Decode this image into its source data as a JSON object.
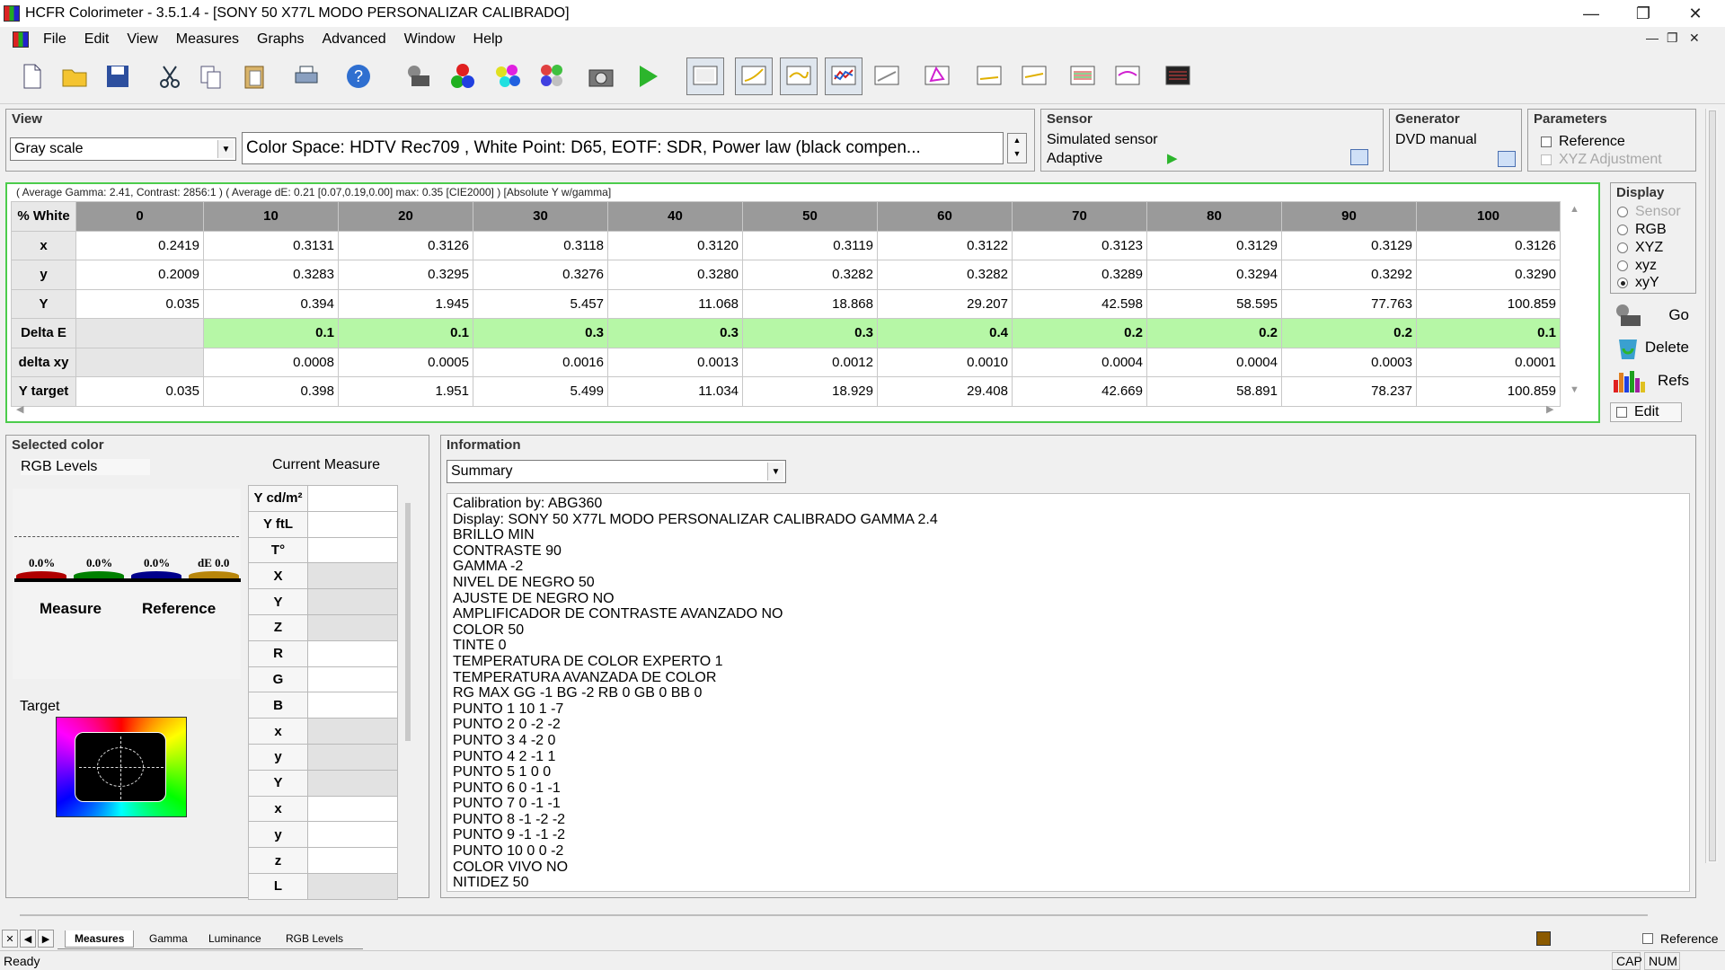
{
  "window": {
    "title": "HCFR Colorimeter - 3.5.1.4 - [SONY 50 X77L MODO PERSONALIZAR CALIBRADO]"
  },
  "menu": [
    "File",
    "Edit",
    "View",
    "Measures",
    "Graphs",
    "Advanced",
    "Window",
    "Help"
  ],
  "view": {
    "title": "View",
    "selection": "Gray scale",
    "colorspace": "Color Space: HDTV Rec709 , White Point: D65, EOTF:  SDR, Power law (black compen..."
  },
  "sensor": {
    "title": "Sensor",
    "name": "Simulated sensor",
    "mode": "Adaptive"
  },
  "generator": {
    "title": "Generator",
    "name": "DVD manual"
  },
  "parameters": {
    "title": "Parameters",
    "reference": "Reference",
    "xyz_adjustment": "XYZ Adjustment"
  },
  "grid": {
    "info": "( Average Gamma: 2.41, Contrast: 2856:1 ) ( Average dE: 0.21 [0.07,0.19,0.00] max: 0.35 [CIE2000] ) [Absolute Y w/gamma]",
    "header_label": "% White",
    "columns": [
      "0",
      "10",
      "20",
      "30",
      "40",
      "50",
      "60",
      "70",
      "80",
      "90",
      "100"
    ],
    "rows": [
      {
        "label": "x",
        "values": [
          "0.2419",
          "0.3131",
          "0.3126",
          "0.3118",
          "0.3120",
          "0.3119",
          "0.3122",
          "0.3123",
          "0.3129",
          "0.3129",
          "0.3126"
        ]
      },
      {
        "label": "y",
        "values": [
          "0.2009",
          "0.3283",
          "0.3295",
          "0.3276",
          "0.3280",
          "0.3282",
          "0.3282",
          "0.3289",
          "0.3294",
          "0.3292",
          "0.3290"
        ]
      },
      {
        "label": "Y",
        "values": [
          "0.035",
          "0.394",
          "1.945",
          "5.457",
          "11.068",
          "18.868",
          "29.207",
          "42.598",
          "58.595",
          "77.763",
          "100.859"
        ]
      },
      {
        "label": "Delta E",
        "values": [
          "",
          "0.1",
          "0.1",
          "0.3",
          "0.3",
          "0.3",
          "0.4",
          "0.2",
          "0.2",
          "0.2",
          "0.1"
        ]
      },
      {
        "label": "delta xy",
        "values": [
          "",
          "0.0008",
          "0.0005",
          "0.0016",
          "0.0013",
          "0.0012",
          "0.0010",
          "0.0004",
          "0.0004",
          "0.0003",
          "0.0001"
        ]
      },
      {
        "label": "Y target",
        "values": [
          "0.035",
          "0.398",
          "1.951",
          "5.499",
          "11.034",
          "18.929",
          "29.408",
          "42.669",
          "58.891",
          "78.237",
          "100.859"
        ]
      }
    ]
  },
  "display": {
    "title": "Display",
    "options": [
      "Sensor",
      "RGB",
      "XYZ",
      "xyz",
      "xyY"
    ],
    "selected": "xyY",
    "buttons": {
      "go": "Go",
      "delete": "Delete",
      "refs": "Refs",
      "edit": "Edit"
    }
  },
  "selected_color": {
    "title": "Selected color",
    "rgb_levels": "RGB Levels",
    "current_measure": "Current Measure",
    "bars": [
      "0.0%",
      "0.0%",
      "0.0%",
      "dE 0.0"
    ],
    "measure": "Measure",
    "reference": "Reference",
    "target": "Target",
    "table_labels": [
      "Y cd/m²",
      "Y ftL",
      "T°",
      "X",
      "Y",
      "Z",
      "R",
      "G",
      "B",
      "x",
      "y",
      "Y",
      "x",
      "y",
      "z",
      "L"
    ]
  },
  "information": {
    "title": "Information",
    "selection": "Summary",
    "text": "Calibration by: ABG360\nDisplay: SONY 50 X77L MODO PERSONALIZAR CALIBRADO GAMMA 2.4\nBRILLO MIN\nCONTRASTE 90\nGAMMA -2\nNIVEL DE NEGRO 50\nAJUSTE DE NEGRO NO\nAMPLIFICADOR DE CONTRASTE AVANZADO NO\nCOLOR 50\nTINTE 0\nTEMPERATURA DE COLOR EXPERTO 1\nTEMPERATURA AVANZADA DE COLOR\nRG MAX GG -1 BG -2 RB 0 GB 0 BB 0\nPUNTO 1 10 1 -7\nPUNTO 2 0 -2 -2\nPUNTO 3 4 -2 0\nPUNTO 4 2 -1 1\nPUNTO 5 1 0 0\nPUNTO 6 0 -1 -1\nPUNTO 7 0 -1 -1\nPUNTO 8 -1 -2 -2\nPUNTO 9 -1 -1 -2\nPUNTO 10 0 0 -2\nCOLOR VIVO NO\nNITIDEZ 50"
  },
  "tabs": [
    "Measures",
    "Gamma",
    "Luminance",
    "RGB Levels"
  ],
  "active_tab": "Measures",
  "status": {
    "text": "Ready",
    "reference": "Reference",
    "cap": "CAP",
    "num": "NUM"
  },
  "colors": {
    "accent_green": "#4ccc4c",
    "delta_fill": "#b6f7a6"
  }
}
